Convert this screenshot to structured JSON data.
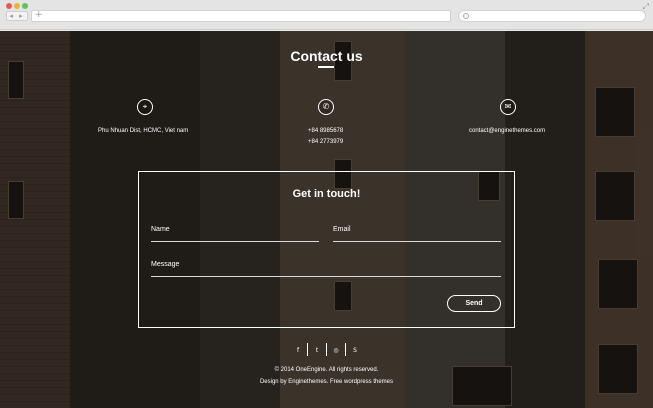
{
  "browser": {
    "nav_glyphs": "◂ ▸",
    "new_tab_glyph": "+",
    "resize_glyph": "⤢"
  },
  "page": {
    "title": "Contact us",
    "contacts": [
      {
        "icon": "location-pin-icon",
        "glyph": "⌖",
        "lines": [
          "Phu Nhuan Dist, HCMC, Viet nam"
        ]
      },
      {
        "icon": "phone-icon",
        "glyph": "✆",
        "lines": [
          "+84 8985678",
          "+84 2773979"
        ]
      },
      {
        "icon": "mail-icon",
        "glyph": "✉",
        "lines": [
          "contact@enginethemes.com"
        ]
      }
    ],
    "form": {
      "title": "Get in touch!",
      "name_placeholder": "Name",
      "email_placeholder": "Email",
      "message_placeholder": "Message",
      "send_label": "Send"
    },
    "social": [
      {
        "name": "facebook-icon",
        "glyph": "f"
      },
      {
        "name": "twitter-icon",
        "glyph": "t"
      },
      {
        "name": "dribbble-icon",
        "glyph": "◎"
      },
      {
        "name": "skype-icon",
        "glyph": "S"
      }
    ],
    "footer": {
      "copyright": "© 2014 OneEngine. All rights reserved.",
      "designed_by": "Design by Enginethemes. Free wordpress themes"
    }
  }
}
